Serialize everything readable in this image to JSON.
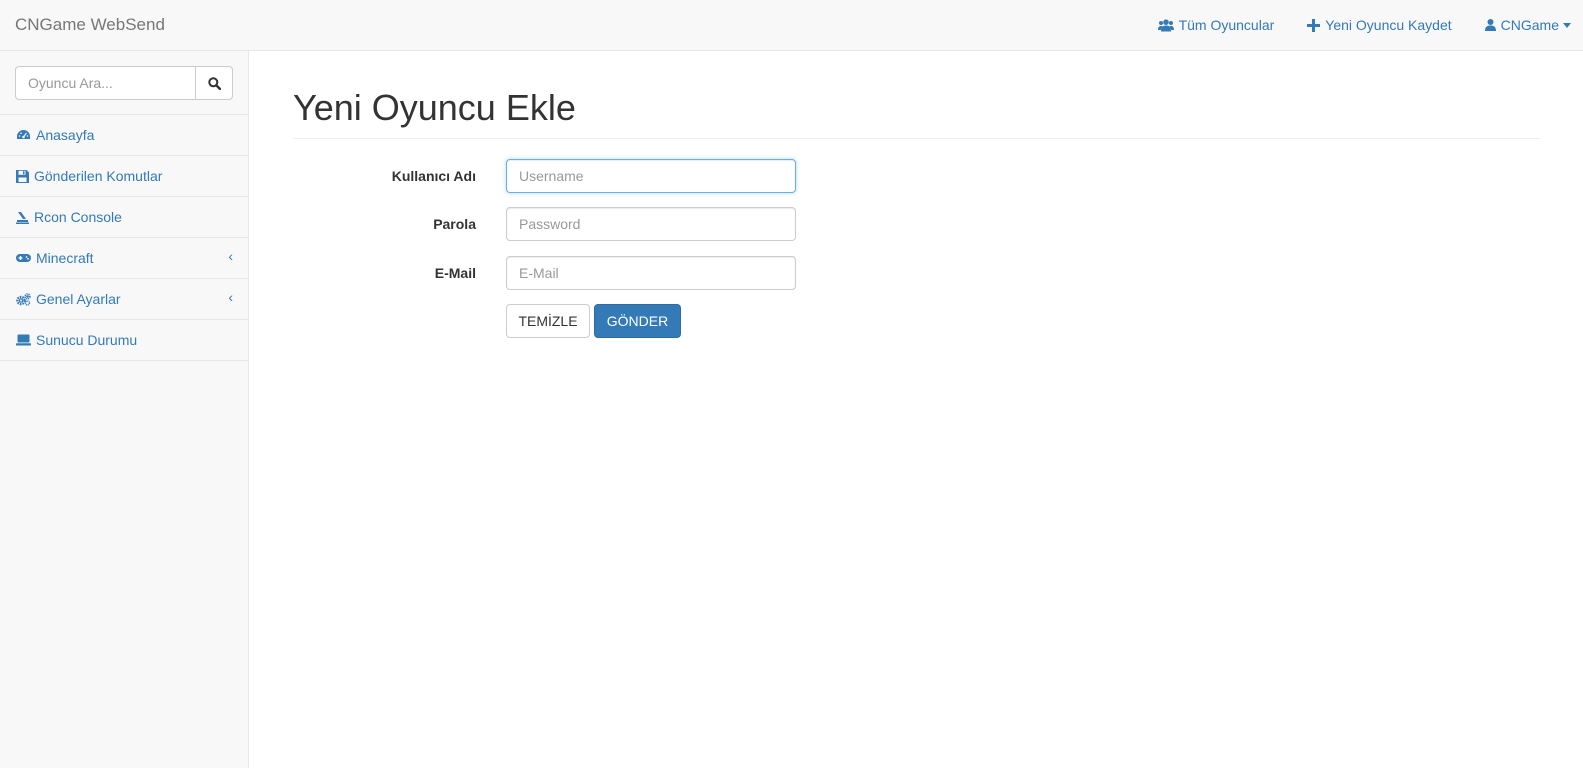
{
  "navbar": {
    "brand": "CNGame WebSend",
    "links": [
      {
        "label": "Tüm Oyuncular",
        "icon": "users-icon"
      },
      {
        "label": "Yeni Oyuncu Kaydet",
        "icon": "plus-icon"
      },
      {
        "label": "CNGame",
        "icon": "user-icon"
      }
    ]
  },
  "sidebar": {
    "search_placeholder": "Oyuncu Ara...",
    "items": [
      {
        "label": "Anasayfa",
        "icon": "dashboard-icon"
      },
      {
        "label": "Gönderilen Komutlar",
        "icon": "floppy-disk-icon"
      },
      {
        "label": "Rcon Console",
        "icon": "terminal-icon"
      },
      {
        "label": "Minecraft",
        "icon": "gamepad-icon",
        "chevron": "‹"
      },
      {
        "label": "Genel Ayarlar",
        "icon": "cogs-icon",
        "chevron": "‹"
      },
      {
        "label": "Sunucu Durumu",
        "icon": "laptop-icon"
      }
    ]
  },
  "main": {
    "title": "Yeni Oyuncu Ekle",
    "form": {
      "username_label": "Kullanıcı Adı",
      "username_placeholder": "Username",
      "password_label": "Parola",
      "password_placeholder": "Password",
      "email_label": "E-Mail",
      "email_placeholder": "E-Mail",
      "clear_button": "TEMİZLE",
      "submit_button": "GÖNDER"
    }
  },
  "colors": {
    "link": "#337ab7",
    "primary": "#337ab7",
    "navbar_bg": "#f8f8f8",
    "border": "#e7e7e7"
  }
}
